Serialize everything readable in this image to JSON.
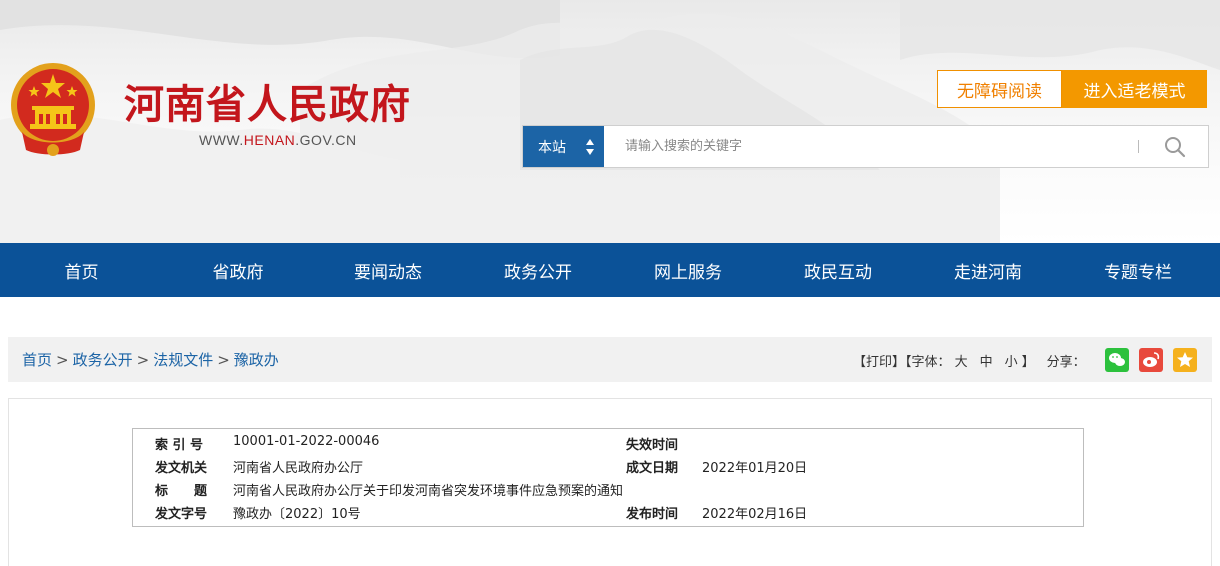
{
  "header": {
    "site_title": "河南省人民政府",
    "url_prefix": "WWW.",
    "url_highlight": "HENAN",
    "url_suffix": ".GOV.CN",
    "accessibility_label": "无障碍阅读",
    "elder_mode_label": "进入适老模式",
    "search": {
      "scope": "本站",
      "placeholder": "请输入搜索的关键字"
    }
  },
  "nav": {
    "items": [
      "首页",
      "省政府",
      "要闻动态",
      "政务公开",
      "网上服务",
      "政民互动",
      "走进河南",
      "专题专栏"
    ]
  },
  "breadcrumb": {
    "items": [
      "首页",
      "政务公开",
      "法规文件",
      "豫政办"
    ],
    "separator": ">"
  },
  "tools": {
    "print": "打印",
    "font_label": "字体：",
    "font_large": "大",
    "font_medium": "中",
    "font_small": "小",
    "share_label": "分享："
  },
  "meta": {
    "index_label": "索 引 号",
    "index_value": "10001-01-2022-00046",
    "expire_label": "失效时间",
    "expire_value": "",
    "issuer_label": "发文机关",
    "issuer_value": "河南省人民政府办公厅",
    "date_label": "成文日期",
    "date_value": "2022年01月20日",
    "title_label": "标　　题",
    "title_value": "河南省人民政府办公厅关于印发河南省突发环境事件应急预案的通知",
    "doc_no_label": "发文字号",
    "doc_no_value": "豫政办〔2022〕10号",
    "publish_label": "发布时间",
    "publish_value": "2022年02月16日"
  },
  "colors": {
    "brand_red": "#c3161c",
    "nav_blue": "#0b5298",
    "accent_orange": "#f39800",
    "link_blue": "#1c64a6"
  }
}
